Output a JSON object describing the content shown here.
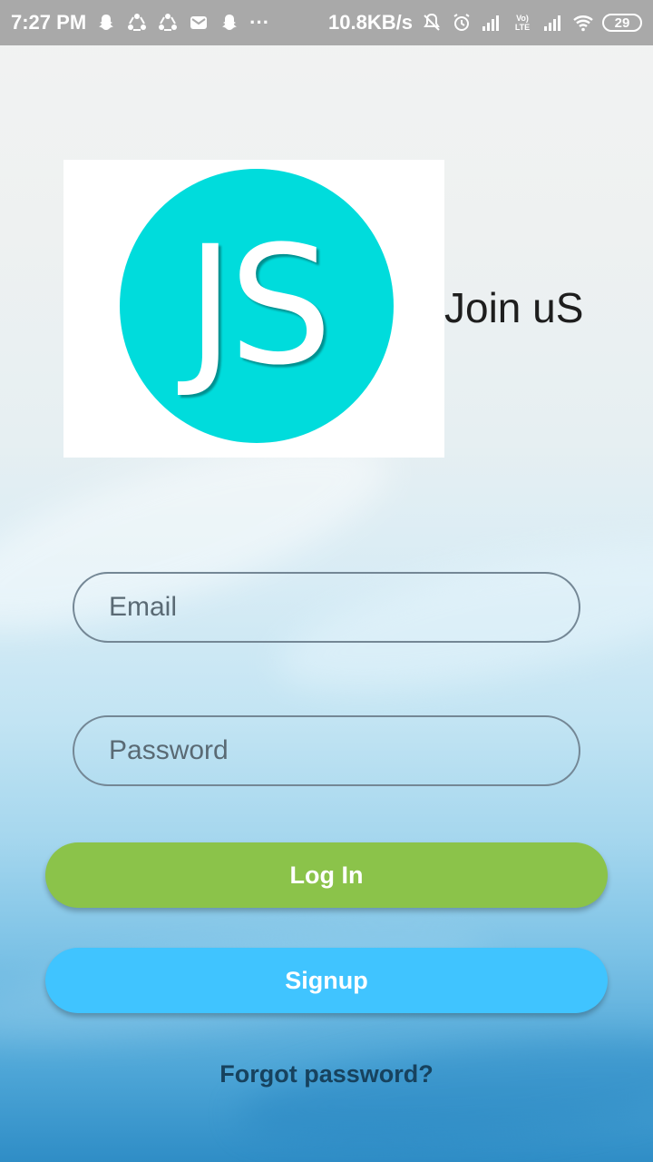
{
  "status_bar": {
    "time": "7:27 PM",
    "more_indicator": "···",
    "net_speed": "10.8KB/s",
    "battery_level": "29",
    "volte_label": "Vo) LTE",
    "left_icons": [
      "snapchat-icon",
      "shareit-icon",
      "shareit-icon",
      "mail-icon",
      "snapchat-icon"
    ],
    "right_icons": [
      "mute-icon",
      "alarm-icon",
      "signal-icon",
      "volte-icon",
      "signal-icon",
      "wifi-icon",
      "battery-icon"
    ]
  },
  "header": {
    "logo_text": "JS",
    "title": "Join uS"
  },
  "form": {
    "email_placeholder": "Email",
    "email_value": "",
    "password_placeholder": "Password",
    "password_value": ""
  },
  "actions": {
    "login_label": "Log In",
    "signup_label": "Signup",
    "forgot_label": "Forgot password?"
  },
  "colors": {
    "login_button": "#8bc34a",
    "signup_button": "#40c4ff",
    "logo_circle": "#00dcdc",
    "status_bar": "#a9a9a9"
  }
}
